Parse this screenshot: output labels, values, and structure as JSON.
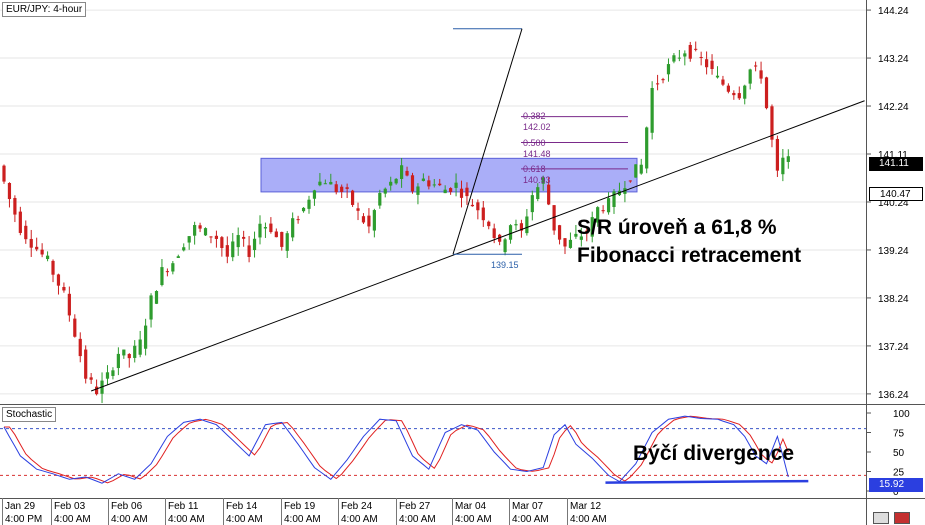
{
  "chart_data": [
    {
      "type": "candlestick",
      "title": "EUR/JPY: 4-hour",
      "y_ticks": [
        "144.24",
        "143.24",
        "142.24",
        "141.11",
        "140.24",
        "139.24",
        "138.24",
        "137.24",
        "136.24"
      ],
      "y_tick_values": [
        144.24,
        143.24,
        142.24,
        141.24,
        140.24,
        139.24,
        138.24,
        137.24,
        136.24
      ],
      "ylim": [
        136.05,
        144.45
      ],
      "x_date_labels": [
        "Jan 29",
        "Feb 03",
        "Feb 06",
        "Feb 11",
        "Feb 14",
        "Feb 19",
        "Feb 24",
        "Feb 27",
        "Mar 04",
        "Mar 07",
        "Mar 12"
      ],
      "x_time_labels": [
        "4:00 PM",
        "4:00 AM",
        "4:00 AM",
        "4:00 AM",
        "4:00 AM",
        "4:00 AM",
        "4:00 AM",
        "4:00 AM",
        "4:00 AM",
        "4:00 AM",
        "4:00 AM"
      ],
      "current_price": "141.11",
      "secondary_price": "140.47",
      "price_path": [
        [
          0,
          141.0
        ],
        [
          2,
          140.3
        ],
        [
          4,
          139.7
        ],
        [
          6,
          139.4
        ],
        [
          9,
          139.0
        ],
        [
          12,
          138.3
        ],
        [
          14,
          137.5
        ],
        [
          16,
          136.6
        ],
        [
          18,
          136.3
        ],
        [
          20,
          136.6
        ],
        [
          22,
          137.1
        ],
        [
          24,
          137.0
        ],
        [
          26,
          137.3
        ],
        [
          28,
          138.2
        ],
        [
          30,
          138.8
        ],
        [
          32,
          139.0
        ],
        [
          34,
          139.4
        ],
        [
          36,
          139.7
        ],
        [
          38,
          139.6
        ],
        [
          40,
          139.5
        ],
        [
          42,
          139.1
        ],
        [
          44,
          139.5
        ],
        [
          46,
          139.2
        ],
        [
          48,
          139.8
        ],
        [
          50,
          139.7
        ],
        [
          52,
          139.3
        ],
        [
          54,
          139.8
        ],
        [
          56,
          140.1
        ],
        [
          58,
          140.6
        ],
        [
          60,
          140.7
        ],
        [
          62,
          140.5
        ],
        [
          64,
          140.4
        ],
        [
          66,
          140.0
        ],
        [
          68,
          139.7
        ],
        [
          70,
          140.4
        ],
        [
          72,
          140.6
        ],
        [
          74,
          140.9
        ],
        [
          76,
          140.5
        ],
        [
          78,
          140.7
        ],
        [
          80,
          140.6
        ],
        [
          82,
          140.5
        ],
        [
          84,
          140.6
        ],
        [
          86,
          140.3
        ],
        [
          88,
          140.1
        ],
        [
          90,
          139.8
        ],
        [
          92,
          139.3
        ],
        [
          94,
          139.8
        ],
        [
          96,
          139.6
        ],
        [
          98,
          140.4
        ],
        [
          100,
          140.7
        ],
        [
          102,
          139.7
        ],
        [
          104,
          139.3
        ],
        [
          106,
          139.5
        ],
        [
          108,
          139.6
        ],
        [
          110,
          140.1
        ],
        [
          112,
          140.2
        ],
        [
          114,
          140.5
        ],
        [
          116,
          140.8
        ],
        [
          118,
          141.0
        ],
        [
          120,
          142.6
        ],
        [
          122,
          142.9
        ],
        [
          124,
          143.2
        ],
        [
          126,
          143.4
        ],
        [
          128,
          143.3
        ],
        [
          130,
          143.1
        ],
        [
          132,
          142.8
        ],
        [
          134,
          142.6
        ],
        [
          136,
          142.5
        ],
        [
          138,
          143.0
        ],
        [
          140,
          142.9
        ],
        [
          142,
          141.5
        ],
        [
          143,
          140.8
        ],
        [
          144,
          141.1
        ]
      ],
      "bars_total": 145,
      "shapes": {
        "sr_zone": [
          141.15,
          140.45
        ],
        "trendline": [
          [
            16,
            136.3
          ],
          [
            158,
            142.35
          ]
        ],
        "fib_high": 143.85,
        "fib_low": 139.15,
        "fib_levels": [
          {
            "ratio": "0.382",
            "price": "142.02"
          },
          {
            "ratio": "0.500",
            "price": "141.48"
          },
          {
            "ratio": "0.618",
            "price": "140.93"
          }
        ],
        "fib_low_label": "139.15"
      }
    },
    {
      "type": "line",
      "title": "Stochastic",
      "y_ticks": [
        "100",
        "75",
        "50",
        "25",
        "0"
      ],
      "y_tick_values": [
        100,
        75,
        50,
        25,
        0
      ],
      "ylim": [
        0,
        100
      ],
      "levels": [
        80,
        20
      ],
      "current_value": "15.92",
      "k_path": [
        [
          0,
          82
        ],
        [
          3,
          45
        ],
        [
          6,
          28
        ],
        [
          9,
          22
        ],
        [
          12,
          15
        ],
        [
          15,
          18
        ],
        [
          18,
          10
        ],
        [
          21,
          22
        ],
        [
          24,
          15
        ],
        [
          27,
          35
        ],
        [
          30,
          70
        ],
        [
          33,
          88
        ],
        [
          36,
          92
        ],
        [
          39,
          85
        ],
        [
          42,
          65
        ],
        [
          45,
          45
        ],
        [
          48,
          85
        ],
        [
          51,
          88
        ],
        [
          54,
          60
        ],
        [
          57,
          30
        ],
        [
          60,
          15
        ],
        [
          63,
          40
        ],
        [
          66,
          70
        ],
        [
          69,
          92
        ],
        [
          72,
          90
        ],
        [
          75,
          45
        ],
        [
          78,
          28
        ],
        [
          81,
          75
        ],
        [
          84,
          85
        ],
        [
          87,
          78
        ],
        [
          90,
          50
        ],
        [
          93,
          28
        ],
        [
          96,
          25
        ],
        [
          99,
          30
        ],
        [
          101,
          72
        ],
        [
          103,
          85
        ],
        [
          105,
          60
        ],
        [
          108,
          42
        ],
        [
          111,
          20
        ],
        [
          113,
          12
        ],
        [
          116,
          35
        ],
        [
          119,
          75
        ],
        [
          122,
          92
        ],
        [
          125,
          96
        ],
        [
          128,
          93
        ],
        [
          131,
          92
        ],
        [
          134,
          85
        ],
        [
          136,
          70
        ],
        [
          138,
          45
        ],
        [
          140,
          35
        ],
        [
          142,
          70
        ],
        [
          143,
          45
        ],
        [
          144,
          18
        ]
      ],
      "divergence_line": [
        [
          113,
          12
        ],
        [
          144,
          14
        ]
      ]
    }
  ],
  "annotations": {
    "sr_text_line1": "S/R úroveň a 61,8 %",
    "sr_text_line2": "Fibonacci retracement",
    "divergence_text": "Býčí divergence"
  },
  "colors": {
    "bull_candle": "#2e9c2e",
    "bear_candle": "#cc1f1f",
    "zone_fill": "#8e93f5",
    "fib_color": "#7a2a8a",
    "fib_swing": "#2a5fa8",
    "stoch_k": "#2b3fe0",
    "stoch_d": "#e02020",
    "axis_highlight": "#2b3fe0"
  }
}
